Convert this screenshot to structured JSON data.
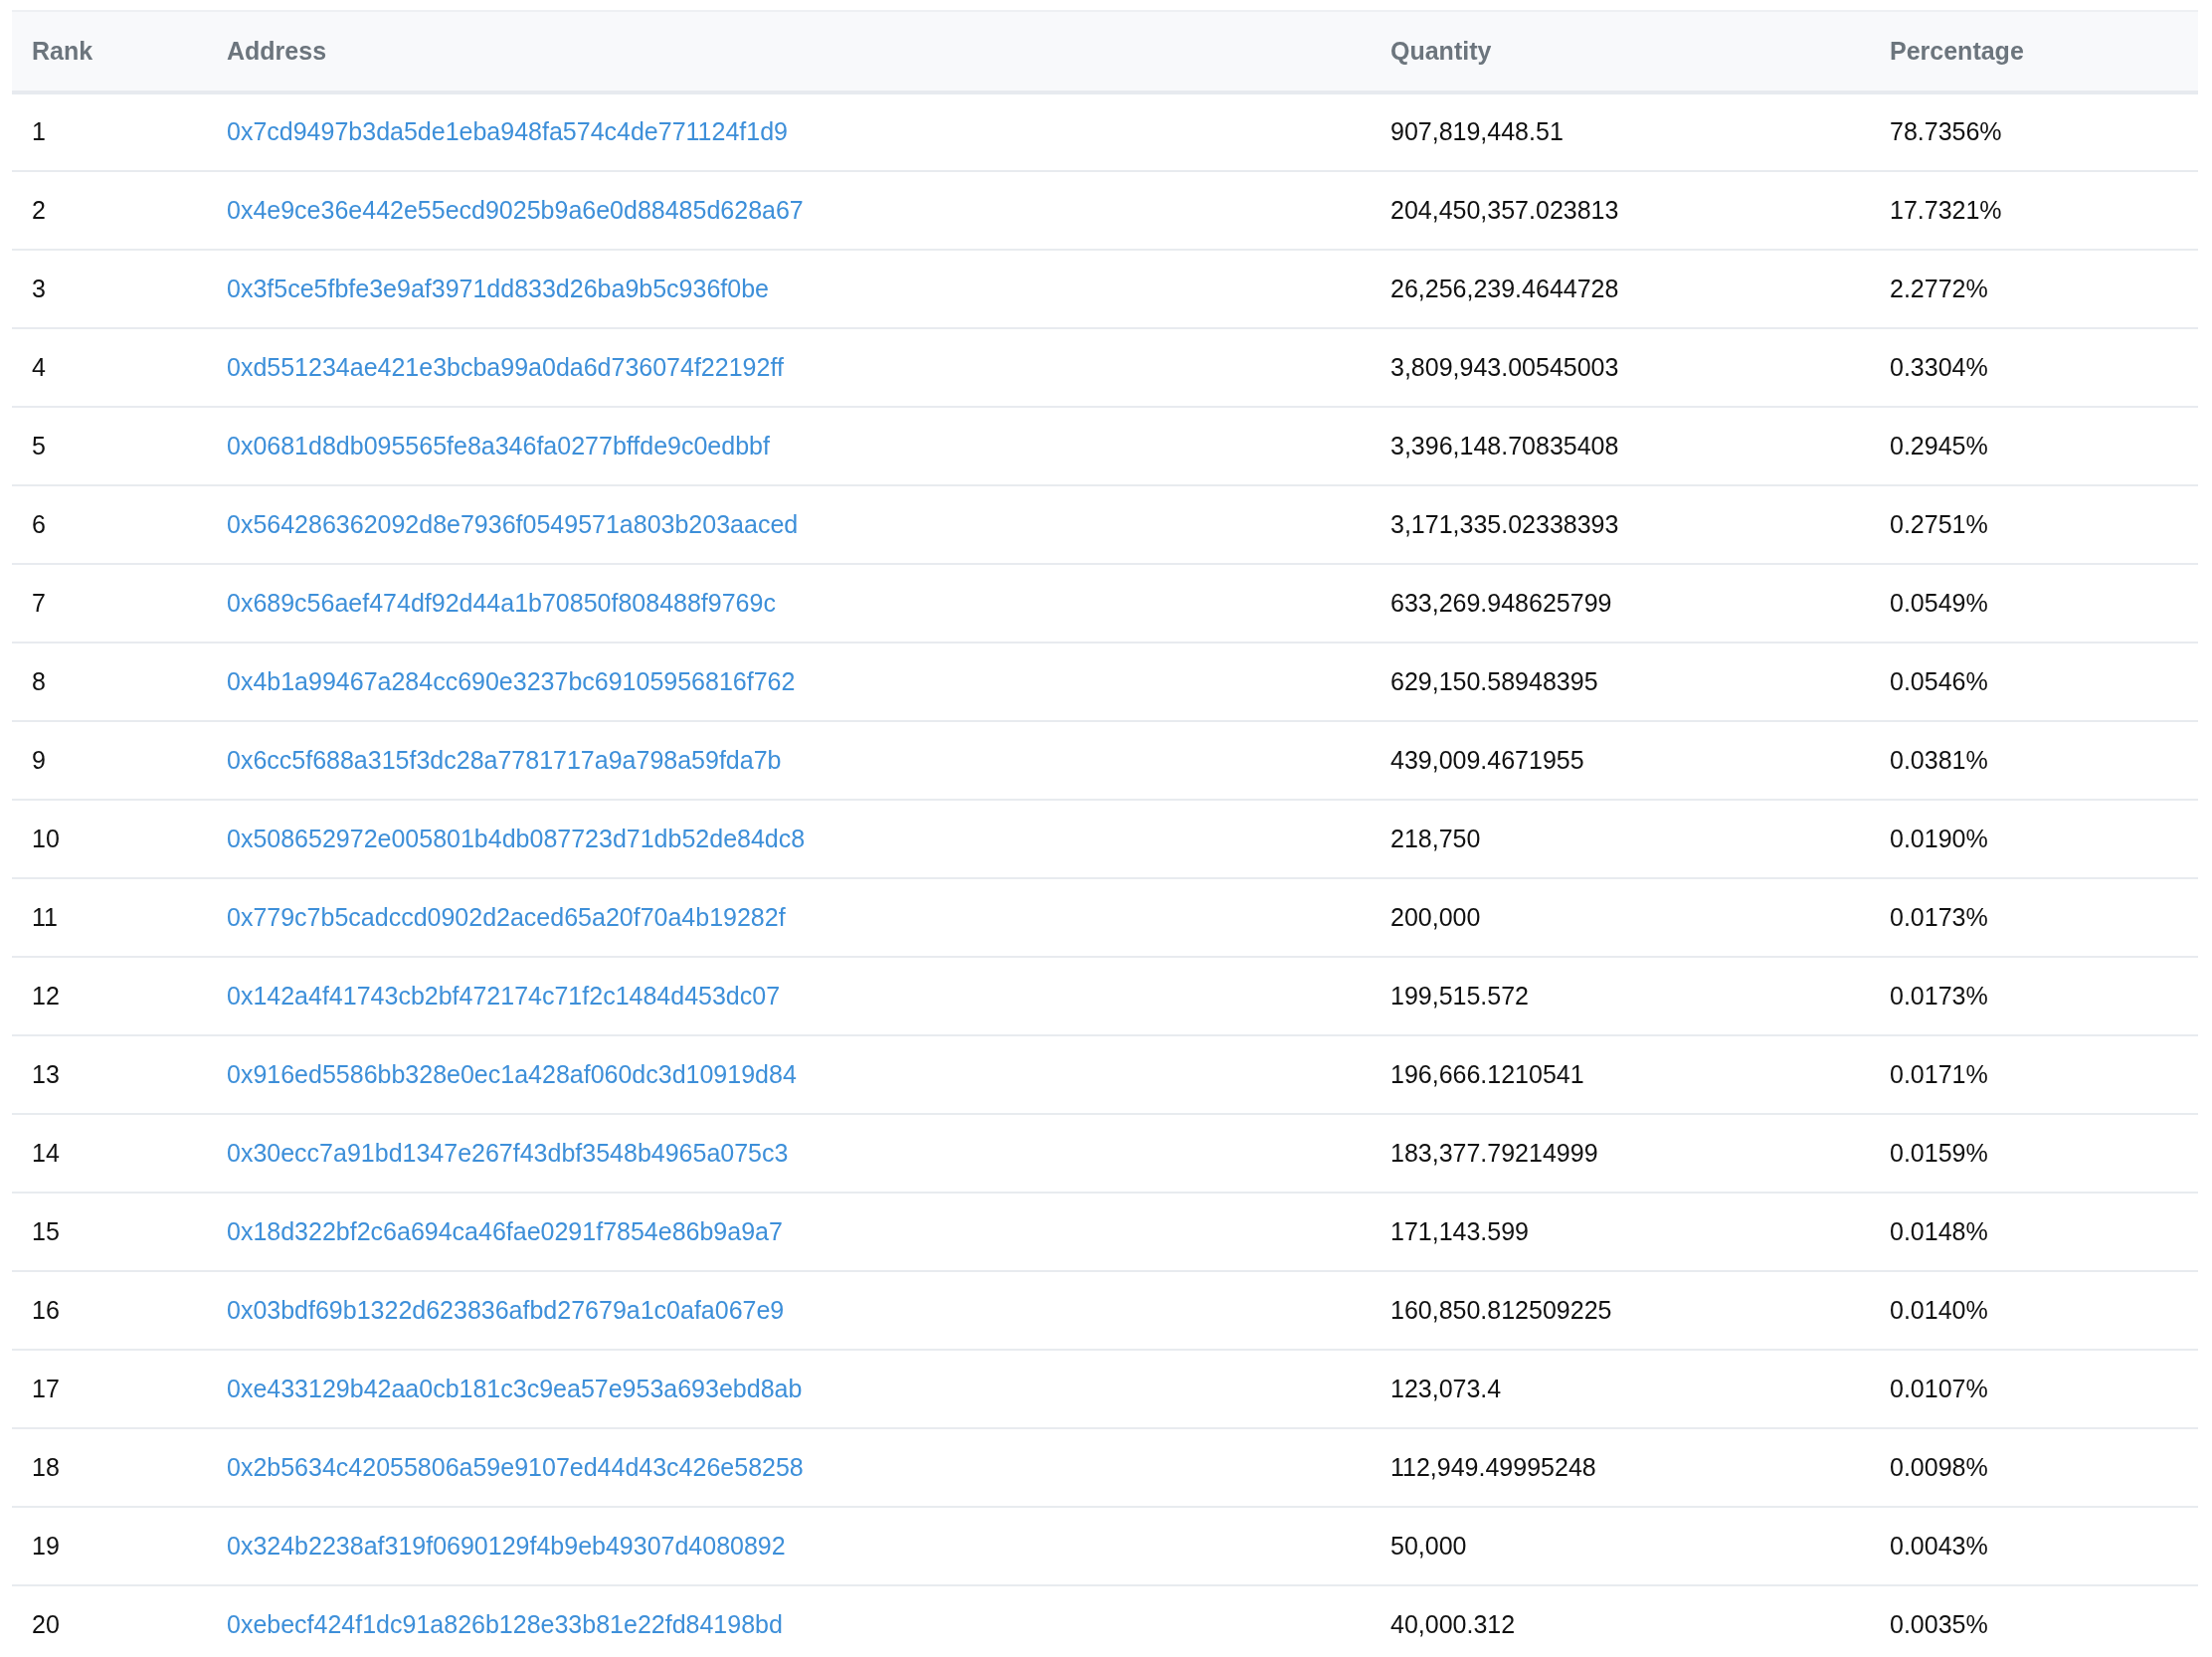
{
  "table": {
    "columns": [
      "Rank",
      "Address",
      "Quantity",
      "Percentage"
    ],
    "rows": [
      {
        "rank": "1",
        "address": "0x7cd9497b3da5de1eba948fa574c4de771124f1d9",
        "quantity": "907,819,448.51",
        "percentage": "78.7356%"
      },
      {
        "rank": "2",
        "address": "0x4e9ce36e442e55ecd9025b9a6e0d88485d628a67",
        "quantity": "204,450,357.023813",
        "percentage": "17.7321%"
      },
      {
        "rank": "3",
        "address": "0x3f5ce5fbfe3e9af3971dd833d26ba9b5c936f0be",
        "quantity": "26,256,239.4644728",
        "percentage": "2.2772%"
      },
      {
        "rank": "4",
        "address": "0xd551234ae421e3bcba99a0da6d736074f22192ff",
        "quantity": "3,809,943.00545003",
        "percentage": "0.3304%"
      },
      {
        "rank": "5",
        "address": "0x0681d8db095565fe8a346fa0277bffde9c0edbbf",
        "quantity": "3,396,148.70835408",
        "percentage": "0.2945%"
      },
      {
        "rank": "6",
        "address": "0x564286362092d8e7936f0549571a803b203aaced",
        "quantity": "3,171,335.02338393",
        "percentage": "0.2751%"
      },
      {
        "rank": "7",
        "address": "0x689c56aef474df92d44a1b70850f808488f9769c",
        "quantity": "633,269.948625799",
        "percentage": "0.0549%"
      },
      {
        "rank": "8",
        "address": "0x4b1a99467a284cc690e3237bc69105956816f762",
        "quantity": "629,150.58948395",
        "percentage": "0.0546%"
      },
      {
        "rank": "9",
        "address": "0x6cc5f688a315f3dc28a7781717a9a798a59fda7b",
        "quantity": "439,009.4671955",
        "percentage": "0.0381%"
      },
      {
        "rank": "10",
        "address": "0x508652972e005801b4db087723d71db52de84dc8",
        "quantity": "218,750",
        "percentage": "0.0190%"
      },
      {
        "rank": "11",
        "address": "0x779c7b5cadccd0902d2aced65a20f70a4b19282f",
        "quantity": "200,000",
        "percentage": "0.0173%"
      },
      {
        "rank": "12",
        "address": "0x142a4f41743cb2bf472174c71f2c1484d453dc07",
        "quantity": "199,515.572",
        "percentage": "0.0173%"
      },
      {
        "rank": "13",
        "address": "0x916ed5586bb328e0ec1a428af060dc3d10919d84",
        "quantity": "196,666.1210541",
        "percentage": "0.0171%"
      },
      {
        "rank": "14",
        "address": "0x30ecc7a91bd1347e267f43dbf3548b4965a075c3",
        "quantity": "183,377.79214999",
        "percentage": "0.0159%"
      },
      {
        "rank": "15",
        "address": "0x18d322bf2c6a694ca46fae0291f7854e86b9a9a7",
        "quantity": "171,143.599",
        "percentage": "0.0148%"
      },
      {
        "rank": "16",
        "address": "0x03bdf69b1322d623836afbd27679a1c0afa067e9",
        "quantity": "160,850.812509225",
        "percentage": "0.0140%"
      },
      {
        "rank": "17",
        "address": "0xe433129b42aa0cb181c3c9ea57e953a693ebd8ab",
        "quantity": "123,073.4",
        "percentage": "0.0107%"
      },
      {
        "rank": "18",
        "address": "0x2b5634c42055806a59e9107ed44d43c426e58258",
        "quantity": "112,949.49995248",
        "percentage": "0.0098%"
      },
      {
        "rank": "19",
        "address": "0x324b2238af319f0690129f4b9eb49307d4080892",
        "quantity": "50,000",
        "percentage": "0.0043%"
      },
      {
        "rank": "20",
        "address": "0xebecf424f1dc91a826b128e33b81e22fd84198bd",
        "quantity": "40,000.312",
        "percentage": "0.0035%"
      }
    ]
  }
}
